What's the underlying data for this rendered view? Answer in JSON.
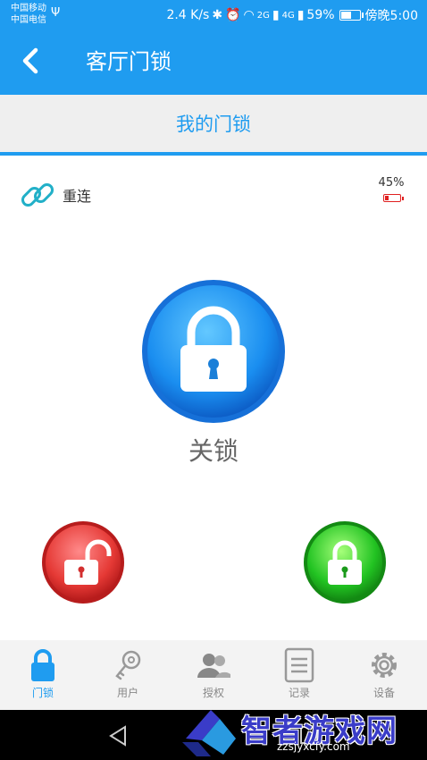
{
  "status_bar": {
    "carrier_1": "中国移动",
    "carrier_2": "中国电信",
    "network_speed": "2.4 K/s",
    "signal_1": "2G",
    "signal_2": "4G",
    "battery_percent_text": "59%",
    "battery_level": 0.59,
    "time": "傍晚5:00",
    "icons": [
      "usb-icon",
      "bluetooth-icon",
      "alarm-icon",
      "wifi-icon",
      "signal-icon",
      "battery-icon"
    ]
  },
  "app_bar": {
    "back_icon": "chevron-left-icon",
    "title": "客厅门锁"
  },
  "section_header": {
    "label": "我的门锁"
  },
  "device": {
    "reconnect_label": "重连",
    "reconnect_icon": "link-icon",
    "battery_percent": "45%",
    "battery_level": 0.25,
    "battery_color": "#e02020"
  },
  "lock": {
    "status": "关锁",
    "main_icon": "padlock-closed-icon"
  },
  "actions": {
    "unlock_icon": "padlock-open-icon",
    "lock_icon": "padlock-closed-icon",
    "unlock_color": "#e53935",
    "lock_color": "#22c322"
  },
  "bottom_nav": {
    "items": [
      {
        "label": "门锁",
        "icon": "padlock-icon",
        "active": true
      },
      {
        "label": "用户",
        "icon": "key-icon",
        "active": false
      },
      {
        "label": "授权",
        "icon": "users-icon",
        "active": false
      },
      {
        "label": "记录",
        "icon": "document-icon",
        "active": false
      },
      {
        "label": "设备",
        "icon": "gear-icon",
        "active": false
      }
    ]
  },
  "watermark": {
    "title": "智者游戏网",
    "url": "zzsjyxcfy.com"
  },
  "colors": {
    "primary": "#1f9cf0",
    "nav_inactive": "#888888"
  }
}
